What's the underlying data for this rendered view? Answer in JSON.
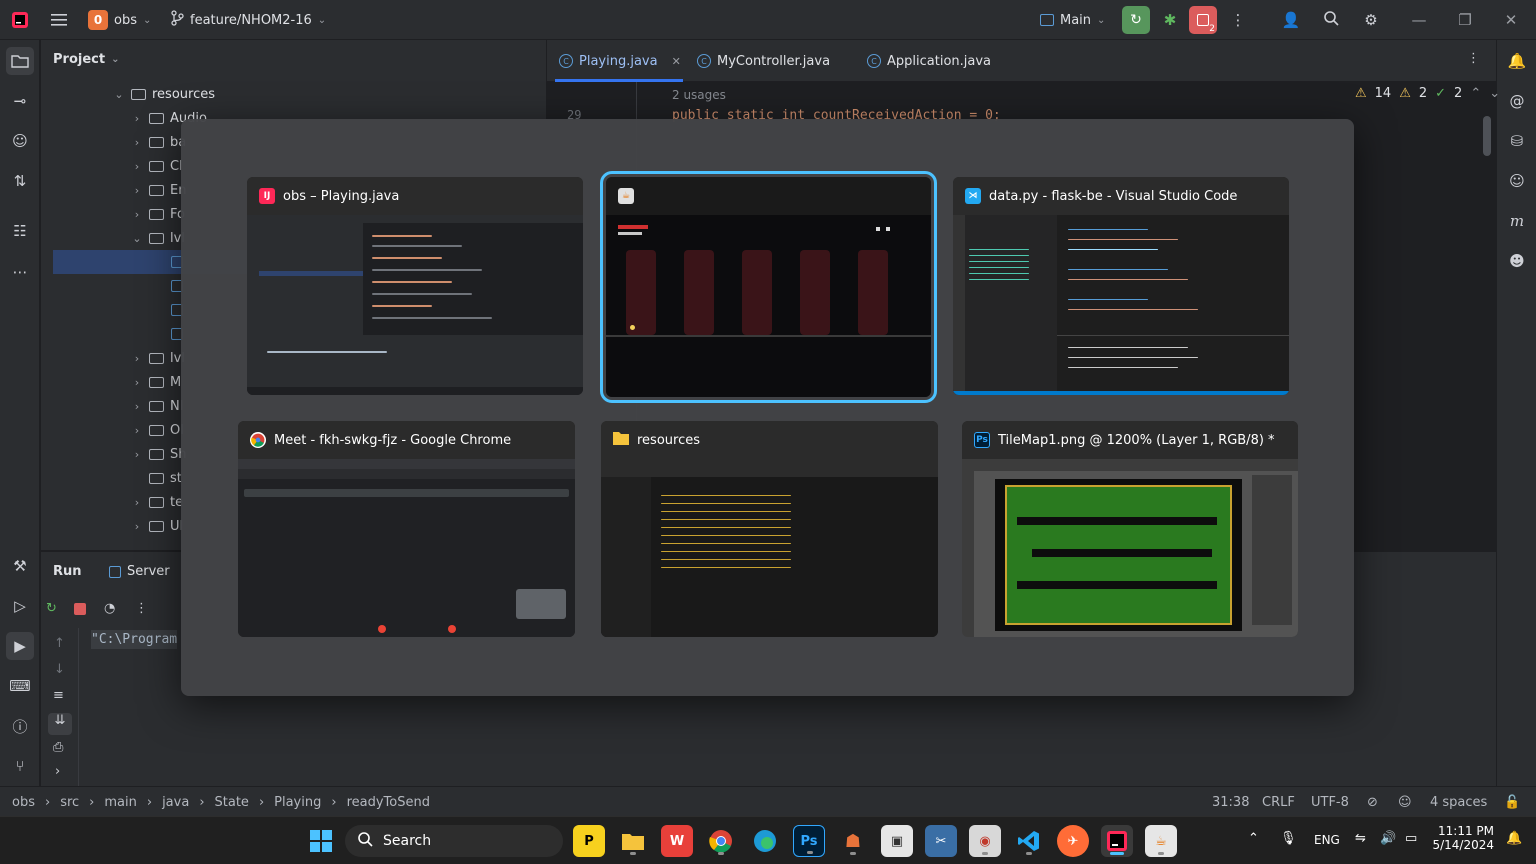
{
  "titlebar": {
    "project_badge": "0",
    "project_name": "obs",
    "branch": "feature/NHOM2-16",
    "run_config": "Main",
    "icons": [
      "app-logo-icon",
      "menu-icon",
      "branch-icon",
      "run-icon",
      "debug-icon",
      "stop-icon",
      "more-icon",
      "add-user-icon",
      "search-icon",
      "settings-icon",
      "minimize-icon",
      "restore-icon",
      "close-icon"
    ],
    "stop_badge": "2"
  },
  "project": {
    "title": "Project",
    "tree": [
      {
        "label": "resources",
        "expanded": true
      },
      {
        "label": "Audio"
      },
      {
        "label": "ba"
      },
      {
        "label": "Cl"
      },
      {
        "label": "En"
      },
      {
        "label": "Fo"
      },
      {
        "label": "lvl",
        "expanded": true
      },
      {
        "label": "lvl"
      },
      {
        "label": "M"
      },
      {
        "label": "NI"
      },
      {
        "label": "Ol"
      },
      {
        "label": "Sh"
      },
      {
        "label": "st"
      },
      {
        "label": "te"
      },
      {
        "label": "UI"
      }
    ]
  },
  "editor": {
    "tabs": [
      {
        "label": "Playing.java",
        "active": true
      },
      {
        "label": "MyController.java"
      },
      {
        "label": "Application.java"
      }
    ],
    "usages": "2 usages",
    "line_number": "29",
    "code_line": "public static int countReceivedAction = 0;",
    "inspections": {
      "warnings": "14",
      "weak_warnings": "2",
      "ok": "2"
    }
  },
  "run": {
    "tab_run": "Run",
    "tab_server": "Server",
    "console_text": "\"C:\\Program"
  },
  "statusbar": {
    "breadcrumb": [
      "obs",
      "src",
      "main",
      "java",
      "State",
      "Playing",
      "readyToSend"
    ],
    "position": "31:38",
    "line_sep": "CRLF",
    "encoding": "UTF-8",
    "indent": "4 spaces"
  },
  "switcher": {
    "windows": [
      {
        "title": "obs – Playing.java",
        "icon": "intellij-icon",
        "selected": false
      },
      {
        "title": "",
        "icon": "game-icon",
        "selected": true
      },
      {
        "title": "data.py - flask-be - Visual Studio Code",
        "icon": "vscode-icon",
        "selected": false
      },
      {
        "title": "Meet - fkh-swkg-fjz - Google Chrome",
        "icon": "chrome-icon",
        "selected": false
      },
      {
        "title": "resources",
        "icon": "folder-icon",
        "selected": false
      },
      {
        "title": "TileMap1.png @ 1200% (Layer 1, RGB/8) *",
        "icon": "photoshop-icon",
        "selected": false
      }
    ]
  },
  "taskbar": {
    "search": "Search",
    "apps": [
      "windows-start-icon",
      "search-icon",
      "pycharm-icon",
      "file-explorer-icon",
      "wps-icon",
      "chrome-icon",
      "edge-icon",
      "photoshop-icon",
      "game-icon",
      "notepad-icon",
      "snipping-icon",
      "remote-icon",
      "vscode-icon",
      "postman-icon",
      "intellij-icon",
      "java-icon"
    ],
    "lang": "ENG",
    "time": "11:11 PM",
    "date": "5/14/2024"
  }
}
